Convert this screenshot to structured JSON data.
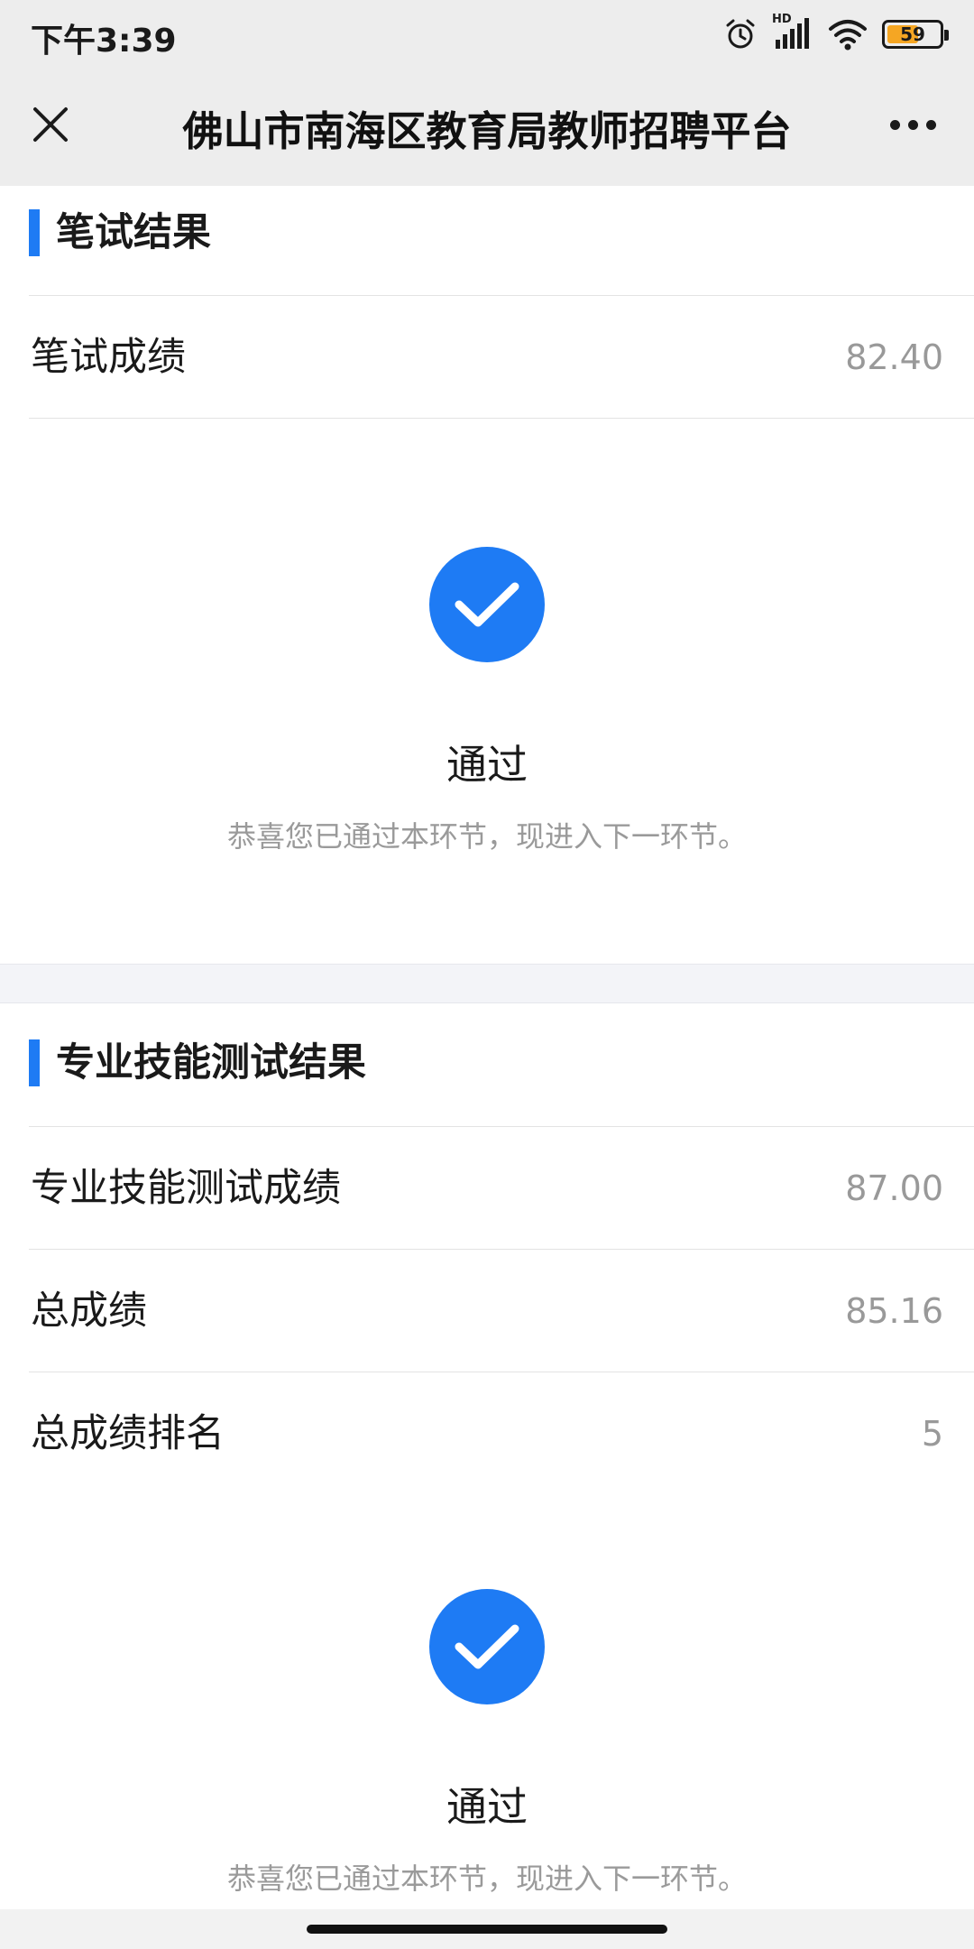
{
  "status_bar": {
    "time": "下午3:39",
    "network_label": "HD",
    "battery_level": "59",
    "icons": [
      "alarm-icon",
      "signal-icon",
      "wifi-icon",
      "battery-icon"
    ]
  },
  "nav": {
    "title": "佛山市南海区教育局教师招聘平台",
    "close_icon": "close-icon",
    "more_icon": "more-icon"
  },
  "written_section": {
    "title": "笔试结果",
    "rows": [
      {
        "label": "笔试成绩",
        "value": "82.40"
      }
    ],
    "result": {
      "status": "通过",
      "message": "恭喜您已通过本环节，现进入下一环节。"
    }
  },
  "skill_section": {
    "title": "专业技能测试结果",
    "rows": [
      {
        "label": "专业技能测试成绩",
        "value": "87.00"
      },
      {
        "label": "总成绩",
        "value": "85.16"
      },
      {
        "label": "总成绩排名",
        "value": "5"
      }
    ],
    "result": {
      "status": "通过",
      "message": "恭喜您已通过本环节，现进入下一环节。"
    }
  },
  "colors": {
    "accent": "#1e7bf4",
    "header_bg": "#ededed",
    "muted_text": "#999999",
    "battery": "#f5a623"
  }
}
